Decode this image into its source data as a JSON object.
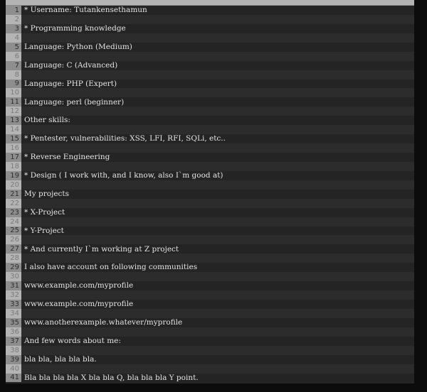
{
  "editor": {
    "lines": [
      "* Username: Tutankensethamun",
      "",
      "* Programming knowledge",
      "",
      "Language: Python (Medium)",
      "",
      "Language: C (Advanced)",
      "",
      "Language: PHP (Expert)",
      "",
      "Language: perl (beginner)",
      "",
      "Other skills:",
      "",
      "* Pentester, vulnerabilities: XSS, LFI, RFI, SQLi, etc..",
      "",
      "* Reverse Engineering",
      "",
      "* Design ( I work with, and I know, also I`m good at)",
      "",
      "My projects",
      "",
      "* X-Project",
      "",
      "* Y-Project",
      "",
      "* And currently I`m working at Z project",
      "",
      "I also have account on following communities",
      "",
      "www.example.com/myprofile",
      "",
      "www.example.com/myprofile",
      "",
      "www.anotherexample.whatever/myprofile",
      "",
      "And few words about me:",
      "",
      "bla bla, bla bla bla.",
      "",
      "Bla bla bla bla X bla bla Q, bla bla bla Y point."
    ]
  }
}
